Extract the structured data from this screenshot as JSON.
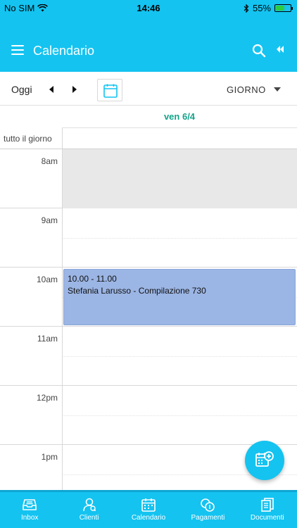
{
  "status_bar": {
    "carrier": "No SIM",
    "time": "14:46",
    "battery": "55%"
  },
  "app_bar": {
    "title": "Calendario"
  },
  "toolbar": {
    "today_label": "Oggi",
    "view_label": "GIORNO"
  },
  "day": {
    "header": "ven 6/4",
    "allday_label": "tutto il giorno"
  },
  "hours": [
    "8am",
    "9am",
    "10am",
    "11am",
    "12pm",
    "1pm"
  ],
  "event": {
    "time": "10.00 - 11.00",
    "title": "Stefania Larusso - Compilazione 730",
    "color": "#9bb5e4"
  },
  "colors": {
    "primary": "#14c3f0",
    "accent": "#14a38a"
  },
  "bottom_nav": {
    "items": [
      {
        "label": "Inbox",
        "icon": "inbox-icon"
      },
      {
        "label": "Clienti",
        "icon": "clients-icon"
      },
      {
        "label": "Calendario",
        "icon": "calendar-icon"
      },
      {
        "label": "Pagamenti",
        "icon": "payments-icon"
      },
      {
        "label": "Documenti",
        "icon": "documents-icon"
      }
    ]
  }
}
